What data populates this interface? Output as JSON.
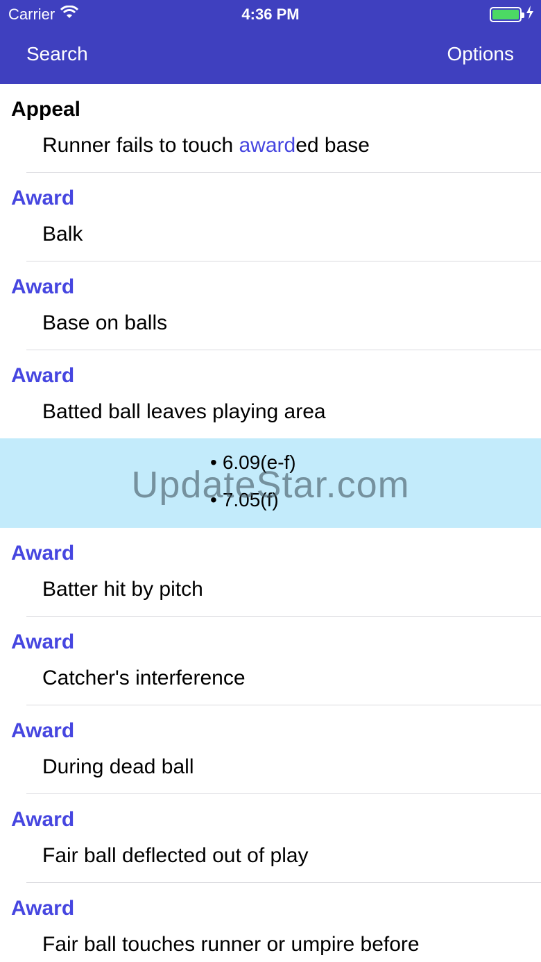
{
  "status": {
    "carrier": "Carrier",
    "time": "4:36 PM"
  },
  "nav": {
    "search_label": "Search",
    "options_label": "Options"
  },
  "rows": [
    {
      "title": "Appeal",
      "desc_before": "Runner fails to touch ",
      "desc_hl": "award",
      "desc_after": "ed base"
    },
    {
      "title": "Award",
      "desc": "Balk"
    },
    {
      "title": "Award",
      "desc": "Base on balls"
    },
    {
      "title": "Award",
      "desc": "Batted ball leaves playing area"
    },
    {
      "title": "Award",
      "desc": "Batter hit by pitch"
    },
    {
      "title": "Award",
      "desc": "Catcher's interference"
    },
    {
      "title": "Award",
      "desc": "During dead ball"
    },
    {
      "title": "Award",
      "desc": "Fair ball deflected out of play"
    },
    {
      "title": "Award",
      "desc": "Fair ball touches runner or umpire before"
    }
  ],
  "expanded_refs": [
    "6.09(e-f)",
    "7.05(f)"
  ],
  "watermark": "UpdateStar.com",
  "colors": {
    "nav_bar": "#3f40bf",
    "accent": "#4646e0",
    "highlight_row": "#c3ebfb",
    "battery": "#4cd964"
  }
}
